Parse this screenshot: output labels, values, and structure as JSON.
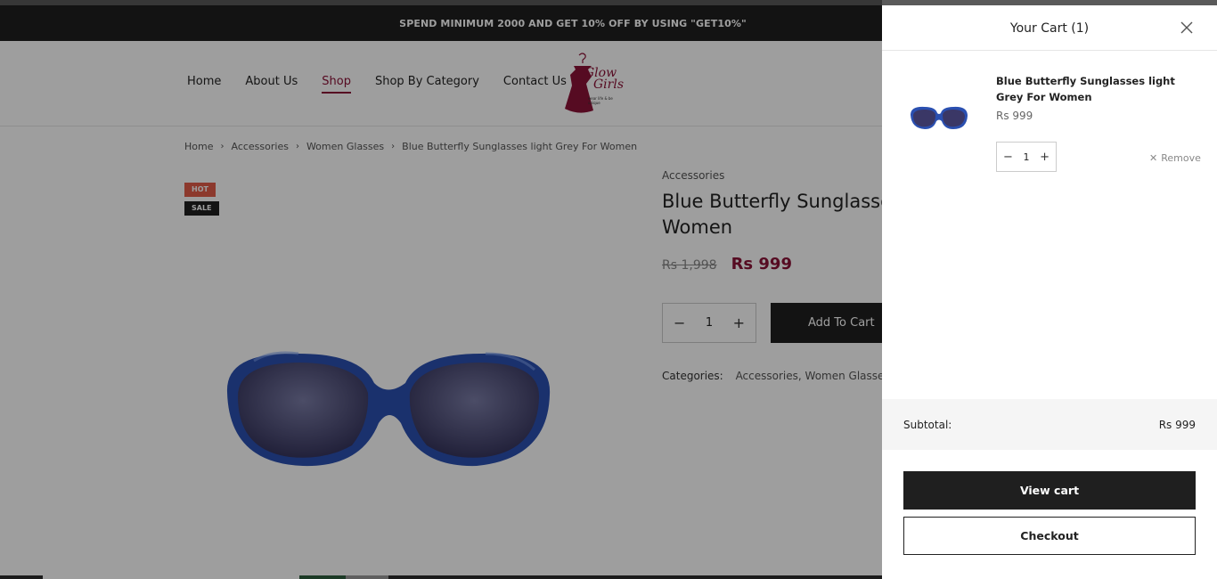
{
  "promo": {
    "text": "SPEND MINIMUM 2000 AND GET 10% OFF BY USING \"GET10%\""
  },
  "nav": {
    "items": [
      {
        "label": "Home"
      },
      {
        "label": "About Us"
      },
      {
        "label": "Shop",
        "active": true
      },
      {
        "label": "Shop By Category"
      },
      {
        "label": "Contact Us"
      }
    ]
  },
  "logo": {
    "line1": "Glow",
    "line2": "Girls",
    "tagline": "wear life & be unique"
  },
  "breadcrumb": {
    "items": [
      "Home",
      "Accessories",
      "Women Glasses"
    ],
    "current": "Blue Butterfly Sunglasses light Grey For Women"
  },
  "badges": {
    "hot": "HOT",
    "sale": "SALE"
  },
  "product": {
    "category": "Accessories",
    "title": "Blue Butterfly Sunglasses light Grey For Women",
    "title_visible": "Blue Butterfly Sunglasses Women",
    "price_old": "Rs 1,998",
    "price_new": "Rs 999",
    "quantity": "1",
    "add_to_cart": "Add To Cart",
    "categories_label": "Categories:",
    "categories": [
      "Accessories",
      "Women Glasses"
    ],
    "category_separator": ","
  },
  "cart": {
    "title": "Your Cart (1)",
    "item": {
      "name": "Blue Butterfly Sunglasses light Grey For Women",
      "price": "Rs 999",
      "quantity": "1",
      "remove_label": "Remove"
    },
    "subtotal_label": "Subtotal:",
    "subtotal_value": "Rs 999",
    "view_cart": "View cart",
    "checkout": "Checkout"
  },
  "colors": {
    "accent": "#8c1237",
    "dark": "#1f1f1f",
    "hot_badge": "#e25c4a",
    "frame_blue": "#2a4fb0"
  }
}
